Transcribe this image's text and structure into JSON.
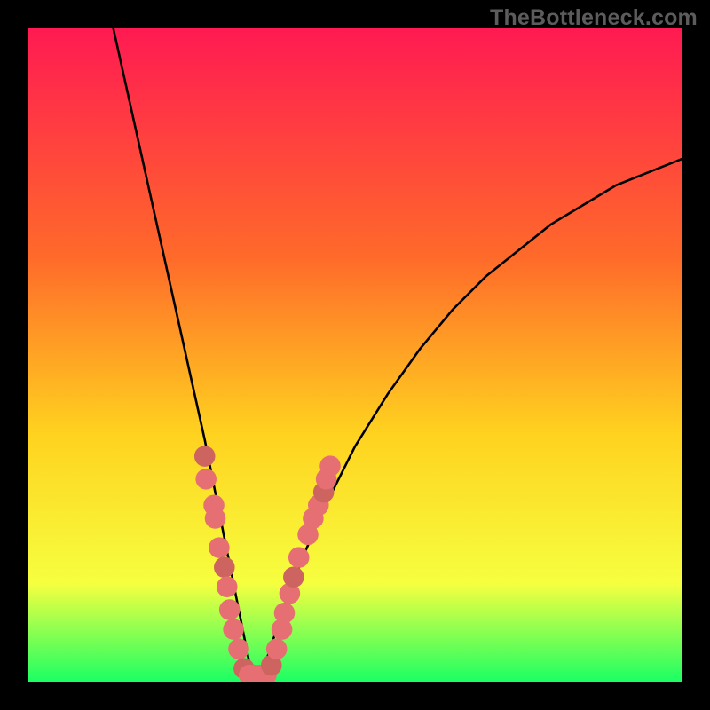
{
  "watermark": "TheBottleneck.com",
  "colors": {
    "frame": "#000000",
    "gradient_top": "#ff1a52",
    "gradient_mid1": "#ff6a2a",
    "gradient_mid2": "#ffd21f",
    "gradient_low": "#f6ff3f",
    "gradient_bottom": "#1bff64",
    "curve": "#000000",
    "dot": "#e66f73",
    "dot_alt": "#cd645f"
  },
  "chart_data": {
    "type": "line",
    "title": "",
    "xlabel": "",
    "ylabel": "",
    "xlim": [
      0,
      100
    ],
    "ylim": [
      0,
      100
    ],
    "curve": {
      "comment": "V-shaped bottleneck curve; vertex near x≈34, y≈0. Values are approximate readings from pixel positions on a 0–100 axis.",
      "x": [
        13,
        15,
        17,
        19,
        21,
        23,
        25,
        27,
        29,
        30,
        31,
        32,
        33,
        34,
        35,
        36,
        37,
        38,
        40,
        42,
        45,
        50,
        55,
        60,
        65,
        70,
        75,
        80,
        85,
        90,
        95,
        100
      ],
      "y": [
        100,
        91,
        82,
        73,
        64,
        55,
        46,
        37,
        27,
        22,
        17,
        12,
        7,
        2,
        1,
        2,
        5,
        8,
        14,
        19,
        26,
        36,
        44,
        51,
        57,
        62,
        66,
        70,
        73,
        76,
        78,
        80
      ]
    },
    "dots": {
      "comment": "Highlighted sample points (salmon) clustered near the valley floor and lower flanks.",
      "points": [
        {
          "x": 27.0,
          "y": 34.5
        },
        {
          "x": 27.2,
          "y": 31.0
        },
        {
          "x": 28.4,
          "y": 27.0
        },
        {
          "x": 28.6,
          "y": 25.0
        },
        {
          "x": 29.2,
          "y": 20.5
        },
        {
          "x": 30.0,
          "y": 17.5
        },
        {
          "x": 30.4,
          "y": 14.5
        },
        {
          "x": 30.8,
          "y": 11.0
        },
        {
          "x": 31.4,
          "y": 8.0
        },
        {
          "x": 32.2,
          "y": 5.0
        },
        {
          "x": 33.0,
          "y": 2.0
        },
        {
          "x": 33.8,
          "y": 1.0
        },
        {
          "x": 34.6,
          "y": 1.0
        },
        {
          "x": 35.4,
          "y": 1.0
        },
        {
          "x": 36.4,
          "y": 1.0
        },
        {
          "x": 37.2,
          "y": 2.5
        },
        {
          "x": 38.0,
          "y": 5.0
        },
        {
          "x": 38.8,
          "y": 8.0
        },
        {
          "x": 39.2,
          "y": 10.5
        },
        {
          "x": 40.0,
          "y": 13.5
        },
        {
          "x": 40.6,
          "y": 16.0
        },
        {
          "x": 41.4,
          "y": 19.0
        },
        {
          "x": 42.8,
          "y": 22.5
        },
        {
          "x": 43.6,
          "y": 25.0
        },
        {
          "x": 44.4,
          "y": 27.0
        },
        {
          "x": 45.2,
          "y": 29.0
        },
        {
          "x": 45.6,
          "y": 31.0
        },
        {
          "x": 46.2,
          "y": 33.0
        }
      ],
      "r": 1.6
    },
    "gradient_stops": [
      {
        "offset": 0.0,
        "key": "gradient_top"
      },
      {
        "offset": 0.35,
        "key": "gradient_mid1"
      },
      {
        "offset": 0.62,
        "key": "gradient_mid2"
      },
      {
        "offset": 0.85,
        "key": "gradient_low"
      },
      {
        "offset": 1.0,
        "key": "gradient_bottom"
      }
    ]
  }
}
